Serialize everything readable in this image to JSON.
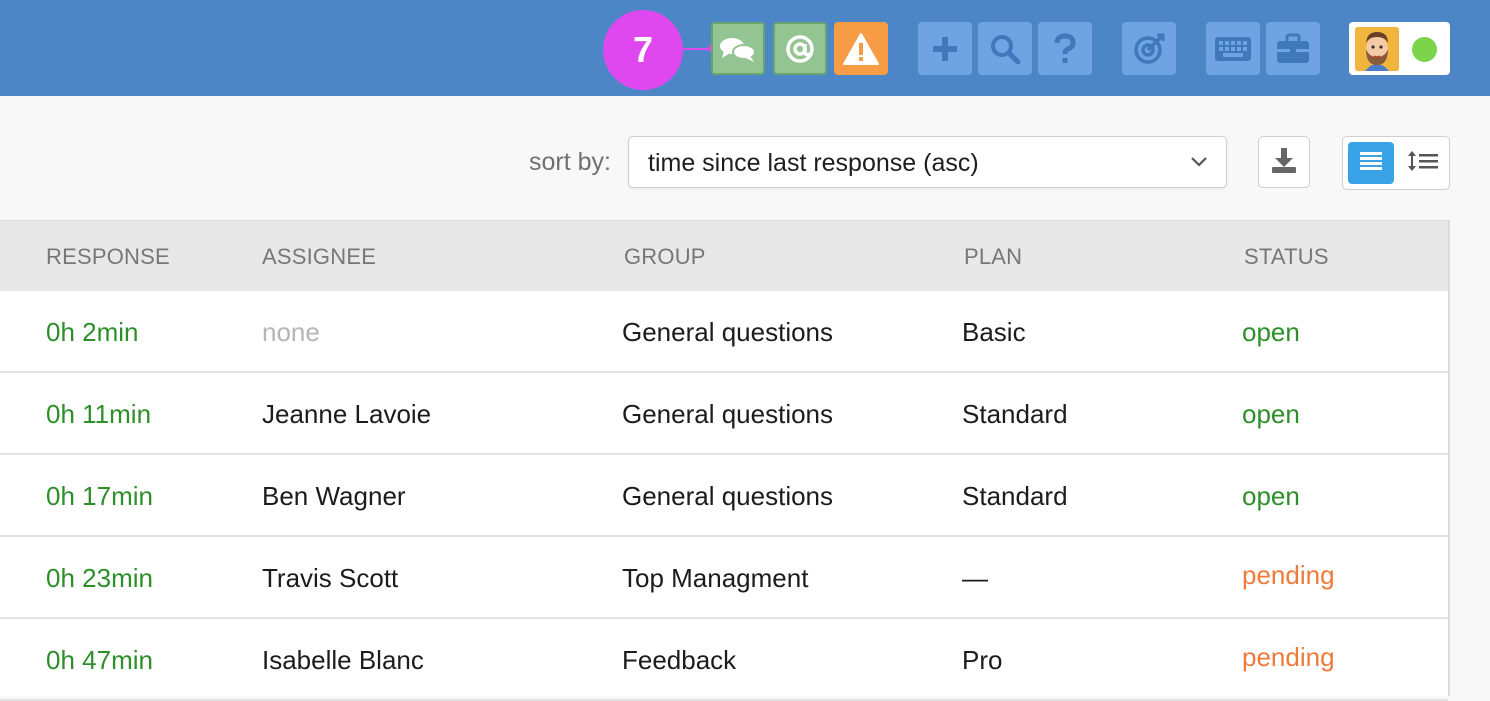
{
  "topbar": {
    "badge_count": "7",
    "buttons": [
      {
        "name": "chats-icon"
      },
      {
        "name": "at-mention-icon"
      },
      {
        "name": "warning-icon"
      },
      {
        "name": "plus-icon"
      },
      {
        "name": "search-icon"
      },
      {
        "name": "help-icon"
      },
      {
        "name": "target-icon"
      },
      {
        "name": "keyboard-icon"
      },
      {
        "name": "briefcase-icon"
      }
    ],
    "colors": {
      "bar": "#4c86c6",
      "badge": "#e048ef",
      "online": "#7bd44a"
    }
  },
  "toolbar": {
    "sort_label": "sort by:",
    "sort_value": "time since last response (asc)"
  },
  "table": {
    "headers": [
      "RESPONSE",
      "ASSIGNEE",
      "GROUP",
      "PLAN",
      "STATUS"
    ],
    "rows": [
      {
        "response": "0h 2min",
        "assignee": "none",
        "group": "General questions",
        "plan": "Basic",
        "status": "open"
      },
      {
        "response": "0h 11min",
        "assignee": "Jeanne Lavoie",
        "group": "General questions",
        "plan": "Standard",
        "status": "open"
      },
      {
        "response": "0h 17min",
        "assignee": "Ben Wagner",
        "group": "General questions",
        "plan": "Standard",
        "status": "open"
      },
      {
        "response": "0h 23min",
        "assignee": "Travis Scott",
        "group": "Top Managment",
        "plan": "—",
        "status": "pending"
      },
      {
        "response": "0h 47min",
        "assignee": "Isabelle Blanc",
        "group": "Feedback",
        "plan": "Pro",
        "status": "pending"
      }
    ]
  }
}
